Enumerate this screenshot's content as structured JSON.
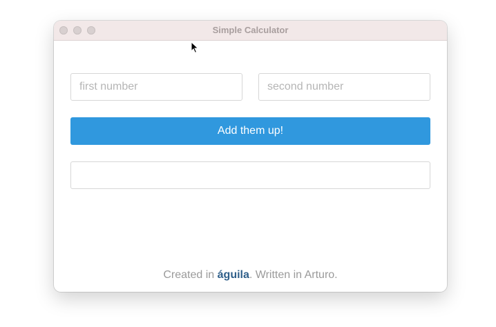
{
  "window": {
    "title": "Simple Calculator"
  },
  "form": {
    "first_placeholder": "first number",
    "second_placeholder": "second number",
    "first_value": "",
    "second_value": "",
    "result_value": ""
  },
  "button": {
    "label": "Add them up!"
  },
  "footer": {
    "prefix": "Created in ",
    "brand": "águila",
    "suffix": ". Written in Arturo."
  },
  "colors": {
    "accent": "#3098de",
    "brand": "#2f5f8a",
    "titlebar": "#f2e8e8"
  },
  "icons": [
    "close-icon",
    "minimize-icon",
    "zoom-icon",
    "mouse-cursor-icon"
  ]
}
